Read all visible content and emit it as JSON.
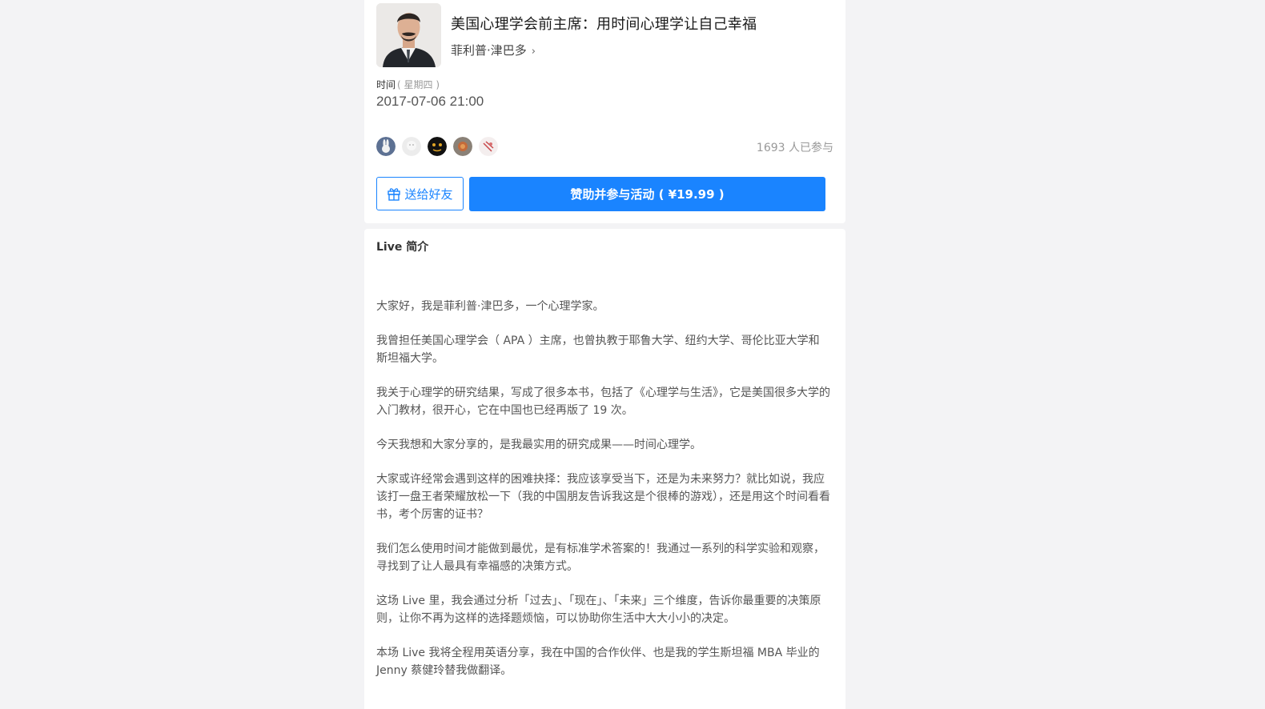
{
  "live": {
    "title": "美国心理学会前主席：用时间心理学让自己幸福",
    "speaker": "菲利普·津巴多",
    "time_label": "时间",
    "weekday": "( 星期四 )",
    "datetime": "2017-07-06 21:00"
  },
  "participants": {
    "avatars": [
      "avatar-rabbit",
      "avatar-light",
      "avatar-dark",
      "avatar-food",
      "avatar-sketch"
    ],
    "count_text": "1693 人已参与"
  },
  "actions": {
    "gift_label": "送给好友",
    "sponsor_label": "赞助并参与活动 ( ¥19.99 )"
  },
  "intro": {
    "heading": "Live 简介",
    "paragraphs": [
      "大家好，我是菲利普·津巴多，一个心理学家。",
      "我曾担任美国心理学会（ APA ）主席，也曾执教于耶鲁大学、纽约大学、哥伦比亚大学和斯坦福大学。",
      "我关于心理学的研究结果，写成了很多本书，包括了《心理学与生活》，它是美国很多大学的入门教材，很开心，它在中国也已经再版了 19 次。",
      "今天我想和大家分享的，是我最实用的研究成果——时间心理学。",
      "大家或许经常会遇到这样的困难抉择：我应该享受当下，还是为未来努力？就比如说，我应该打一盘王者荣耀放松一下（我的中国朋友告诉我这是个很棒的游戏），还是用这个时间看看书，考个厉害的证书？",
      "我们怎么使用时间才能做到最优，是有标准学术答案的！我通过一系列的科学实验和观察，寻找到了让人最具有幸福感的决策方式。",
      "这场 Live 里，我会通过分析「过去」、「现在」、「未来」三个维度，告诉你最重要的决策原则，让你不再为这样的选择题烦恼，可以协助你生活中大大小小的决定。",
      "本场 Live 我将全程用英语分享，我在中国的合作伙伴、也是我的学生斯坦福 MBA 毕业的 Jenny 蔡健玲替我做翻译。"
    ]
  },
  "colors": {
    "accent": "#1a84ff",
    "page_bg": "#f3f3f5"
  }
}
